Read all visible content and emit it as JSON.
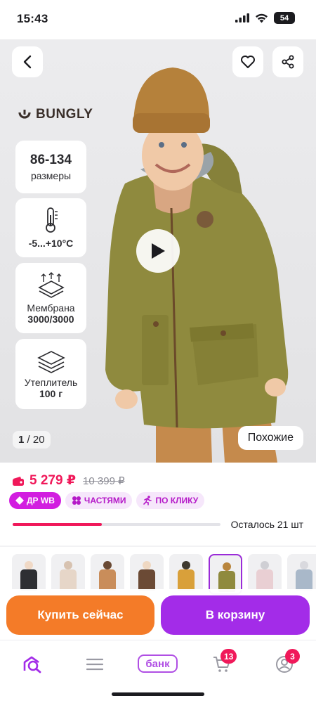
{
  "status_bar": {
    "time": "15:43",
    "battery": "54",
    "signal_icon": "cellular-signal-icon",
    "wifi_icon": "wifi-icon"
  },
  "product": {
    "brand": "BUNGLY",
    "features": [
      {
        "value": "86-134",
        "caption": "размеры"
      },
      {
        "value": "",
        "caption": "-5...+10°C",
        "icon": "thermometer-icon"
      },
      {
        "value": "",
        "caption": "Мембрана",
        "caption2": "3000/3000",
        "icon": "membrane-icon"
      },
      {
        "value": "",
        "caption": "Утеплитель",
        "caption2": "100 г",
        "icon": "insulation-icon"
      }
    ],
    "image_counter": {
      "current": "1",
      "total": "/ 20"
    },
    "similar_label": "Похожие"
  },
  "pricing": {
    "price": "5 279 ₽",
    "old_price": "10 399 ₽",
    "wallet_icon": "wallet-icon",
    "badges": [
      {
        "label": "ДР WB",
        "icon": "tag-icon"
      },
      {
        "label": "ЧАСТЯМИ",
        "icon": "split-payment-icon"
      },
      {
        "label": "ПО КЛИКУ",
        "icon": "running-person-icon"
      }
    ],
    "stock_text": "Осталось 21 шт",
    "stock_progress": 0.43
  },
  "thumbnails": [
    {
      "coat": "#2e2f33",
      "head": "#f0d9c6"
    },
    {
      "coat": "#e6d6c8",
      "head": "#d7c2b0"
    },
    {
      "coat": "#c98d5a",
      "head": "#6a4a34"
    },
    {
      "coat": "#6b4a35",
      "head": "#efd8c2"
    },
    {
      "coat": "#d9a03a",
      "head": "#3f3a2f"
    },
    {
      "coat": "#8f8a3e",
      "head": "#b9853d",
      "selected": true
    },
    {
      "coat": "#e9cfd3",
      "head": "#cfcfd4"
    },
    {
      "coat": "#a9b8c9",
      "head": "#d9d9de"
    }
  ],
  "actions": {
    "buy_now": "Купить сейчас",
    "add_to_cart": "В корзину"
  },
  "tabbar": {
    "bank_label": "банк",
    "cart_count": "13",
    "profile_count": "3"
  },
  "colors": {
    "accent": "#f0195a",
    "purple": "#a32ce8",
    "orange": "#f47b28"
  }
}
